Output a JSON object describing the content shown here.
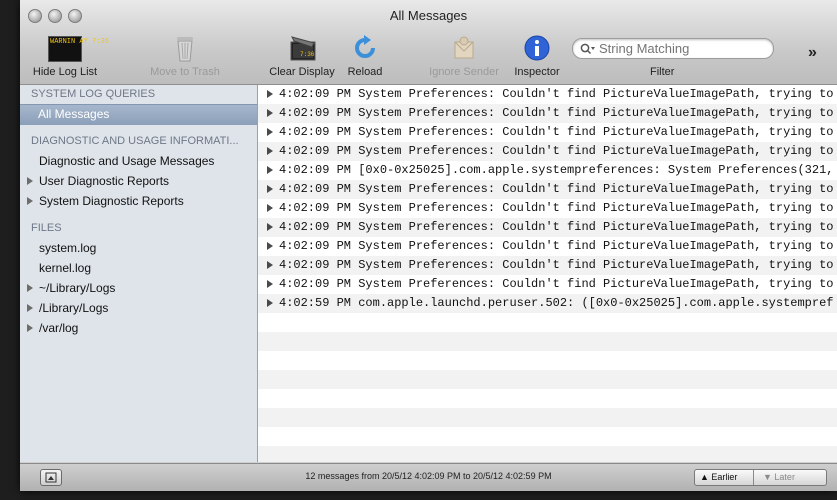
{
  "window": {
    "title": "All Messages"
  },
  "toolbar": {
    "hide_log_list": "Hide Log List",
    "move_to_trash": "Move to Trash",
    "clear_display": "Clear Display",
    "reload": "Reload",
    "ignore_sender": "Ignore Sender",
    "inspector": "Inspector",
    "filter": "Filter",
    "search_placeholder": "String Matching",
    "log_icon_text": "WARNIN AY 7:36"
  },
  "sidebar": {
    "sections": [
      {
        "title": "SYSTEM LOG QUERIES",
        "items": [
          {
            "label": "All Messages",
            "selected": true
          }
        ]
      },
      {
        "title": "DIAGNOSTIC AND USAGE INFORMATI...",
        "items": [
          {
            "label": "Diagnostic and Usage Messages"
          },
          {
            "label": "User Diagnostic Reports",
            "expandable": true
          },
          {
            "label": "System Diagnostic Reports",
            "expandable": true
          }
        ]
      },
      {
        "title": "FILES",
        "items": [
          {
            "label": "system.log"
          },
          {
            "label": "kernel.log"
          },
          {
            "label": "~/Library/Logs",
            "expandable": true
          },
          {
            "label": "/Library/Logs",
            "expandable": true
          },
          {
            "label": "/var/log",
            "expandable": true
          }
        ]
      }
    ]
  },
  "messages": [
    "4:02:09 PM System Preferences: Couldn't find PictureValueImagePath, trying to",
    "4:02:09 PM System Preferences: Couldn't find PictureValueImagePath, trying to",
    "4:02:09 PM System Preferences: Couldn't find PictureValueImagePath, trying to",
    "4:02:09 PM System Preferences: Couldn't find PictureValueImagePath, trying to",
    "4:02:09 PM [0x0-0x25025].com.apple.systempreferences: System Preferences(321,",
    "4:02:09 PM System Preferences: Couldn't find PictureValueImagePath, trying to",
    "4:02:09 PM System Preferences: Couldn't find PictureValueImagePath, trying to",
    "4:02:09 PM System Preferences: Couldn't find PictureValueImagePath, trying to",
    "4:02:09 PM System Preferences: Couldn't find PictureValueImagePath, trying to",
    "4:02:09 PM System Preferences: Couldn't find PictureValueImagePath, trying to",
    "4:02:09 PM System Preferences: Couldn't find PictureValueImagePath, trying to",
    "4:02:59 PM com.apple.launchd.peruser.502: ([0x0-0x25025].com.apple.systempref"
  ],
  "status": {
    "text": "12 messages from 20/5/12 4:02:09 PM to 20/5/12 4:02:59 PM",
    "earlier": "Earlier",
    "later": "Later"
  },
  "colors": {
    "selection": "#9aabc4",
    "sidebar_bg": "#dfe4ea",
    "stripe": "#f2f2f2",
    "inspector_blue": "#2f63d6"
  }
}
